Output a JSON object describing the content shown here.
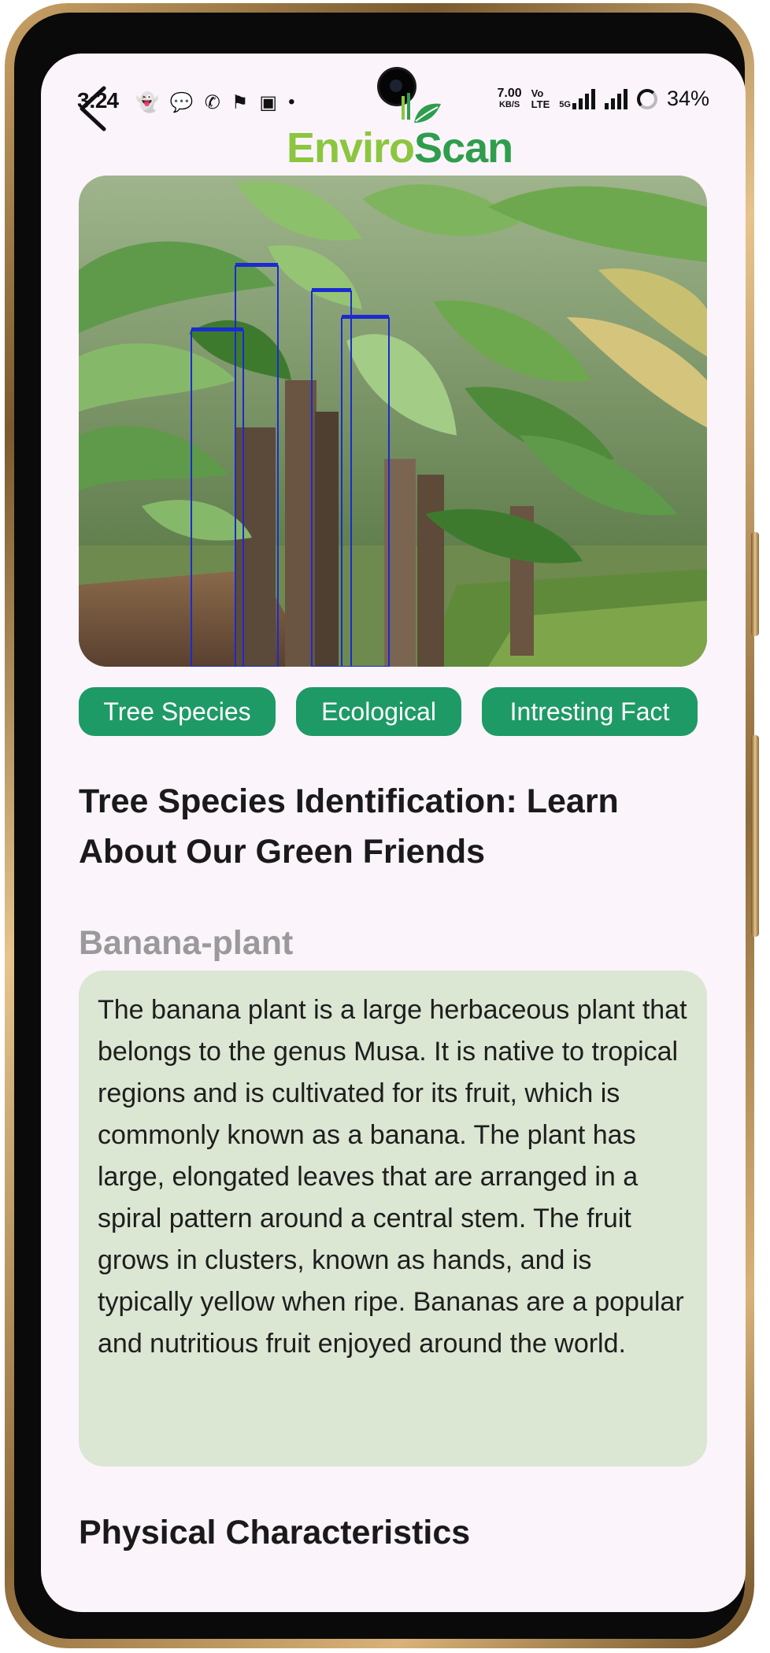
{
  "status_bar": {
    "time": "3:24",
    "net_speed": "7.00",
    "net_speed_unit": "KB/S",
    "volte_top": "Vo",
    "volte_bottom": "LTE",
    "network": "5G",
    "battery": "34%"
  },
  "app": {
    "logo_part1": "Enviro",
    "logo_part2": "Scan",
    "brand_colors": {
      "light_green": "#8cc63f",
      "dark_green": "#2e9e4c",
      "chip_green": "#1e9a66",
      "card_bg": "#dbe6d3"
    }
  },
  "tabs": [
    {
      "label": "Tree Species"
    },
    {
      "label": "Ecological"
    },
    {
      "label": "Intresting Fact"
    }
  ],
  "content": {
    "title": "Tree Species Identification: Learn About Our Green Friends",
    "species": "Banana-plant",
    "description": "The banana plant is a large herbaceous plant that belongs to the genus Musa. It is native to tropical regions and is cultivated for its fruit, which is commonly known as a banana. The plant has large, elongated leaves that are arranged in a spiral pattern around a central stem. The fruit grows in clusters, known as hands, and is typically yellow when ripe. Bananas are a popular and nutritious fruit enjoyed around the world.",
    "section_heading": "Physical Characteristics"
  },
  "detections": {
    "count": 4,
    "box_color": "#1a2bd0"
  }
}
